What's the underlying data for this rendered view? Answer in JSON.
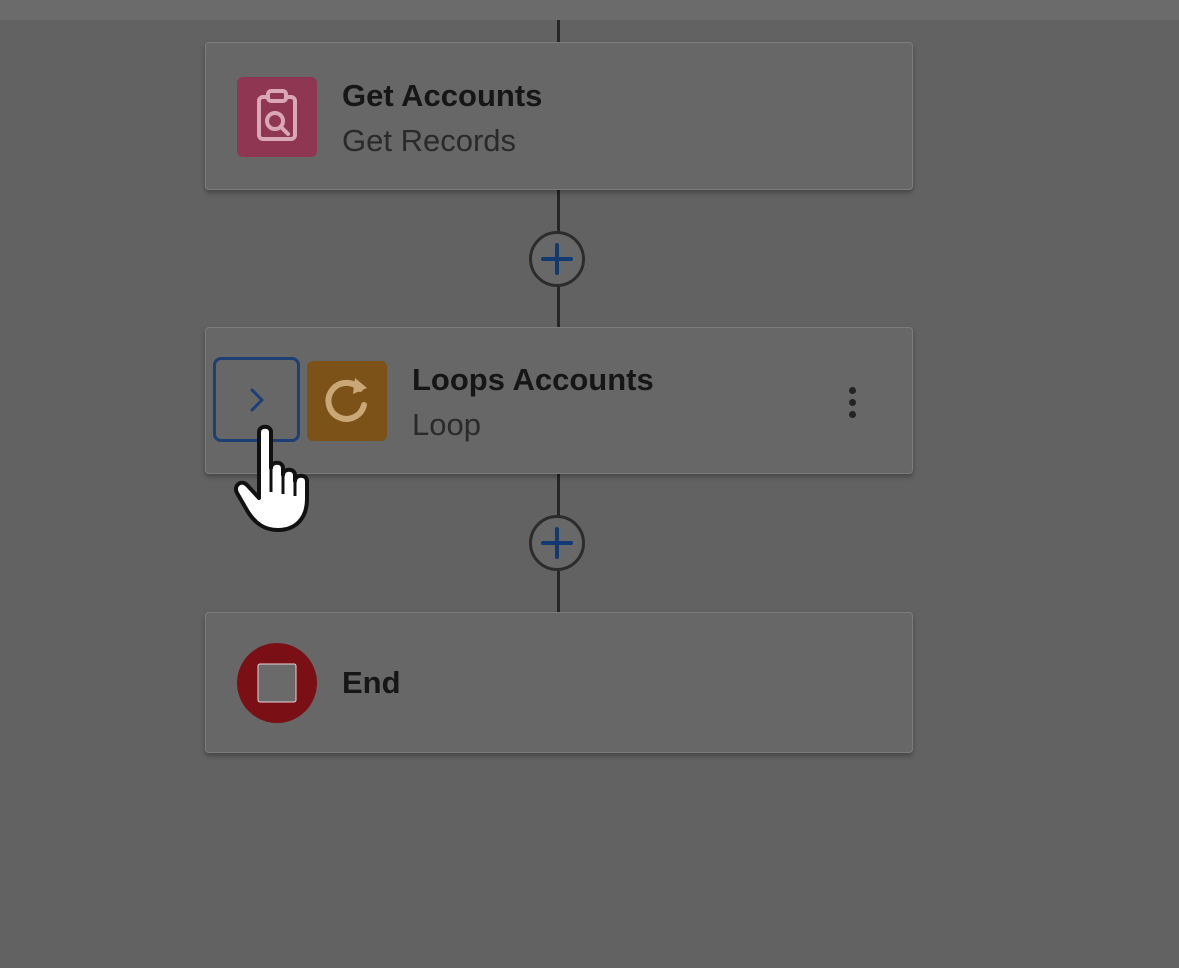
{
  "flow": {
    "nodes": [
      {
        "title": "Get Accounts",
        "subtitle": "Get Records",
        "icon": "get-records-icon",
        "icon_color": "#8f3653"
      },
      {
        "title": "Loops Accounts",
        "subtitle": "Loop",
        "icon": "loop-icon",
        "icon_color": "#7c5218"
      },
      {
        "title": "End",
        "subtitle": "",
        "icon": "end-stop-icon",
        "icon_color": "#7a0f16"
      }
    ],
    "add_buttons": [
      {
        "icon": "plus-icon"
      },
      {
        "icon": "plus-icon"
      }
    ],
    "expand_button_icon": "chevron-right-icon",
    "menu_icon": "more-vertical-icon",
    "cursor_icon": "hand-pointer-icon"
  }
}
